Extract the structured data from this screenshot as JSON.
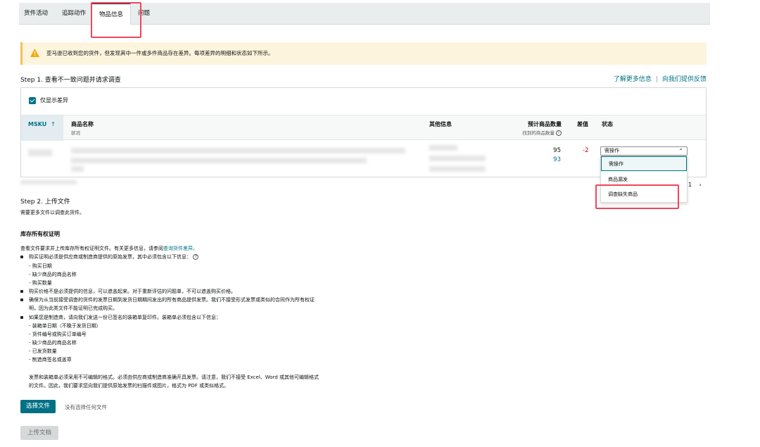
{
  "tabs": [
    {
      "label": "货件活动"
    },
    {
      "label": "追踪动作"
    },
    {
      "label": "物品信息"
    },
    {
      "label": "问题"
    }
  ],
  "warning": {
    "text": "亚马逊已收到您的货件，但发现其中一件或多件商品存在差异。每项差异的明细和状态如下所示。",
    "color": "#f3c256"
  },
  "step1": {
    "title": "Step 1. 查看不一致问题并请求调查",
    "link_more": "了解更多信息",
    "link_feedback": "向我们提供反馈"
  },
  "filter": {
    "label": "仅显示差异",
    "checked": true
  },
  "table": {
    "headers": {
      "msku": "MSKU",
      "sort": "↑",
      "name": "商品名称",
      "name_sub": "状况",
      "other": "其他信息",
      "qty": "预计商品数量",
      "qty_sub": "找到的商品数量",
      "diff": "差值",
      "status": "状态"
    },
    "row": {
      "expected": "95",
      "found": "93",
      "diff": "-2"
    }
  },
  "status_dropdown": {
    "value": "需操作",
    "options": [
      "需操作",
      "商品漏发",
      "调查缺失商品"
    ]
  },
  "pager": {
    "page": "1",
    "next": "›"
  },
  "step2": {
    "title": "Step 2. 上传文件",
    "subtitle": "需要更多文件以调查此货件。"
  },
  "ownership": {
    "title": "库存所有权证明",
    "intro": "查看文件要求并上传库存所有权证明文件。有关更多信息，请参阅",
    "intro_link": "查询货件差异。",
    "b1": "购买证明必须是供应商或制造商提供的原始发票，其中必须包含以下信息：",
    "b1_items": [
      "- 购买日期",
      "- 缺少商品的商品名称",
      "- 购买数量"
    ],
    "b2": "购买价格不是必须提供的信息，可以遮盖起来。对于重新评估的问题单，不可以遮盖购买价格。",
    "b3": "确保为从当前接受调查的货件的发票日期到发货日期期间发出的所有商品提供发票。我们不接受形式发票或类似的合同作为所有权证",
    "b3_cont": "明，因为此类文件不能证明已完成购买。",
    "b4": "如果您是制造商，请向我们发送一份已签名的装箱单复印件。装箱单必须包含以下信息：",
    "b4_items": [
      "- 装箱单日期（不晚于发货日期）",
      "- 货件编号或购买订单编号",
      "- 缺少商品的商品名称",
      "- 已发货数量",
      "- 制造商签名或盖章"
    ],
    "note1": "发票和装箱单必须采用不可编辑的格式。必须由供应商或制造商准确开具发票。请注意，我们不接受 Excel、Word 或其他可编辑格式",
    "note2": "的文件。因此，我们要求您向我们提供原始发票的扫描件或图片，格式为 PDF 或类似格式。"
  },
  "upload": {
    "choose_label": "选择文件",
    "no_file": "没有选择任何文件",
    "upload_label": "上传文档"
  },
  "colors": {
    "accent": "#007185",
    "highlight": "#f0465a",
    "error": "#c40000"
  }
}
